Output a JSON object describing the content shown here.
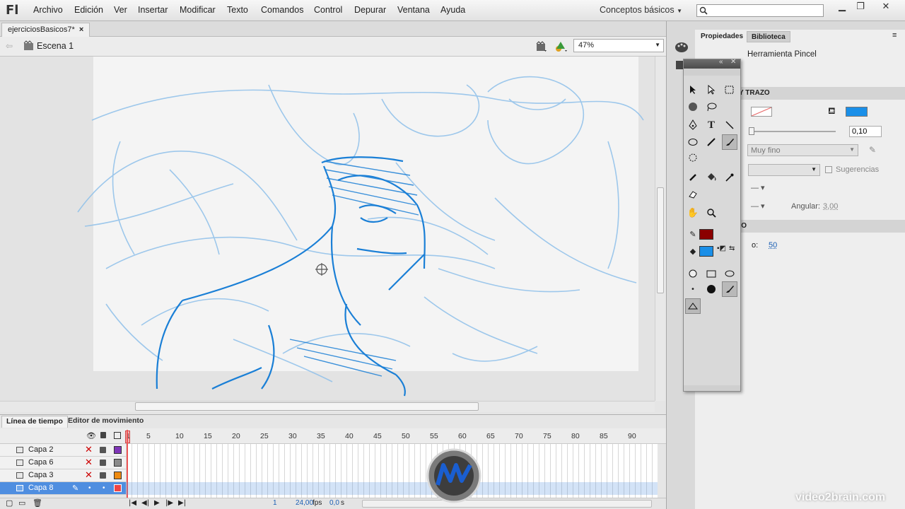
{
  "app": {
    "logo": "Fl"
  },
  "menu": [
    "Archivo",
    "Edición",
    "Ver",
    "Insertar",
    "Modificar",
    "Texto",
    "Comandos",
    "Control",
    "Depurar",
    "Ventana",
    "Ayuda"
  ],
  "workspace": "Conceptos básicos",
  "document": {
    "tab": "ejerciciosBasicos7*",
    "close": "×",
    "scene": "Escena 1",
    "zoom": "47%"
  },
  "timeline": {
    "tabs": [
      "Línea de tiempo",
      "Editor de movimiento"
    ],
    "frame_numbers": [
      "1",
      "5",
      "10",
      "15",
      "20",
      "25",
      "30",
      "35",
      "40",
      "45",
      "50",
      "55",
      "60",
      "65",
      "70",
      "75",
      "80",
      "85",
      "90"
    ],
    "layers": [
      {
        "name": "Capa 2",
        "color": "#7f35b8",
        "selected": false
      },
      {
        "name": "Capa 6",
        "color": "#8a8a8a",
        "selected": false
      },
      {
        "name": "Capa 3",
        "color": "#ee8a10",
        "selected": false
      },
      {
        "name": "Capa 8",
        "color": "#ee4444",
        "selected": true
      }
    ],
    "footer": {
      "current_frame": "1",
      "fps": "24,00",
      "fps_unit": "fps",
      "time": "0,0",
      "time_unit": "s"
    }
  },
  "properties": {
    "tabs": [
      "Propiedades",
      "Biblioteca"
    ],
    "tool_name": "Herramienta Pincel",
    "section_fill": "Y TRAZO",
    "stroke_value": "0,10",
    "style": "Muy fino",
    "hints_label": "Sugerencias",
    "angular_label": "Angular:",
    "angular_value": "3,00",
    "section_smooth": "DO",
    "smooth_label": "o:",
    "smooth_value": "50",
    "fill_color": "#1a8fe8",
    "stroke_color": "#e8a0a0"
  },
  "tools": {
    "stroke_swatch": "#8b0000",
    "fill_swatch": "#1a8fe8"
  },
  "watermark": "video2brain.com"
}
